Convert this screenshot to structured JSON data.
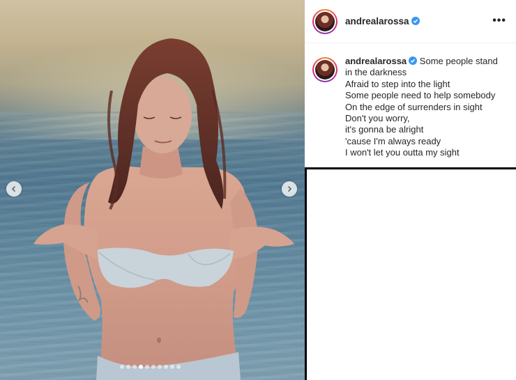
{
  "post": {
    "username": "andrealarossa",
    "verified": true,
    "more_icon": "ellipsis-icon",
    "caption_lines": [
      "Some people stand",
      "in the darkness",
      "Afraid to step into the light",
      "Some people need to help somebody",
      "On the edge of surrenders in sight",
      "Don't you worry,",
      "it's gonna be alright",
      "'cause I'm always ready",
      "I won't let you outta my sight"
    ],
    "carousel": {
      "total": 10,
      "active_index": 3
    }
  },
  "colors": {
    "verified_blue": "#3897f0",
    "text": "#262626",
    "ring_gradient": [
      "#f58529",
      "#dd2a7b",
      "#8134af"
    ]
  }
}
